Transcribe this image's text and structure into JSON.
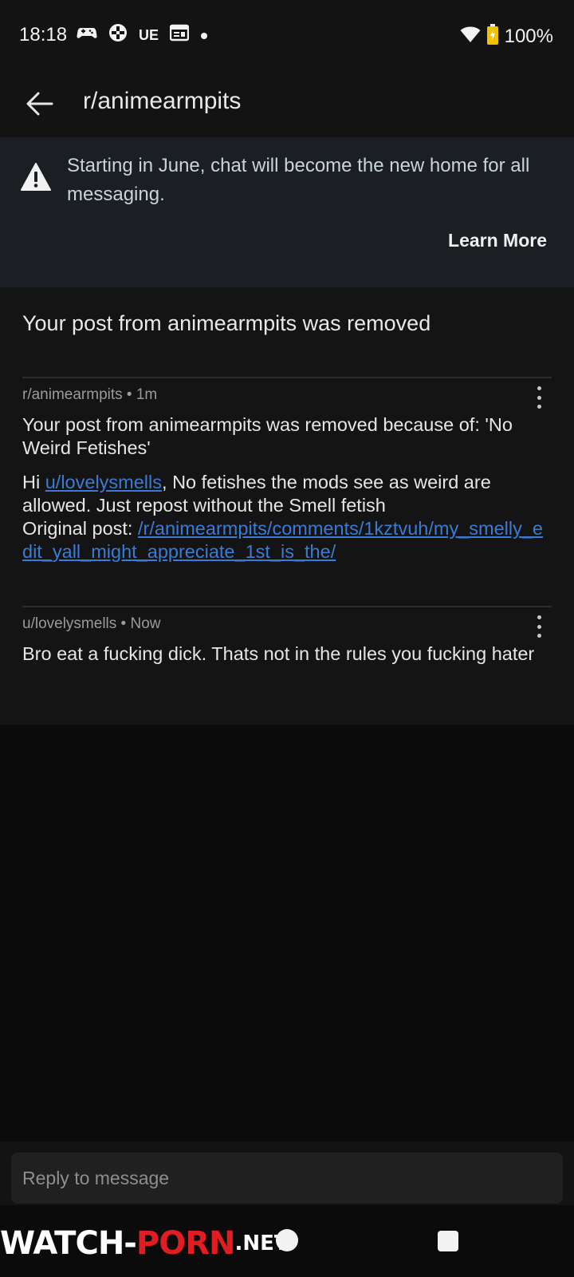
{
  "status_bar": {
    "time": "18:18",
    "icon_ue": "UE",
    "battery": "100%",
    "icons": [
      "game-controller-icon",
      "gamepad-icon",
      "calendar-icon",
      "dot-icon",
      "wifi-icon",
      "battery-icon"
    ]
  },
  "header": {
    "title": "r/animearmpits"
  },
  "banner": {
    "text": "Starting in June, chat will become the new home for all messaging.",
    "action": "Learn More"
  },
  "thread": {
    "title": "Your post from animearmpits was removed",
    "messages": [
      {
        "meta": "r/animearmpits • 1m",
        "subject": "Your post from animearmpits was removed because of: 'No Weird Fetishes'",
        "greeting_prefix": "Hi ",
        "user_link": "u/lovelysmells",
        "body_rest": ", No fetishes the mods see as weird are allowed. Just repost without the Smell fetish",
        "original_label": "Original post: ",
        "original_link": "/r/animearmpits/comments/1kztvuh/my_smelly_edit_yall_might_appreciate_1st_is_the/"
      },
      {
        "meta": "u/lovelysmells • Now",
        "body": "Bro eat a fucking dick. Thats not in the rules you fucking hater"
      }
    ]
  },
  "reply": {
    "placeholder": "Reply to message"
  },
  "watermark": {
    "part1": "WATCH-",
    "part2": "PORN",
    "part3": ".NET"
  },
  "colors": {
    "background": "#0b0b0b",
    "banner_bg": "#1b1f24",
    "link": "#3a7bd5",
    "watermark_red": "#e11d24"
  }
}
